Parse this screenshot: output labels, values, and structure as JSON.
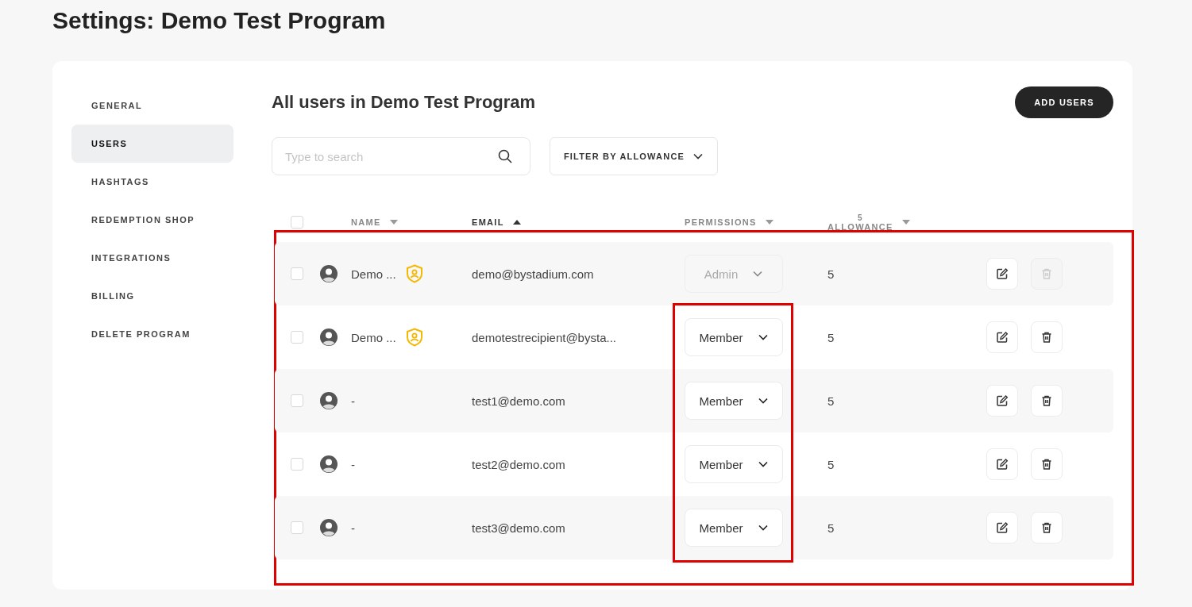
{
  "page_title": "Settings: Demo Test Program",
  "sidebar": {
    "items": [
      {
        "label": "GENERAL",
        "selected": false
      },
      {
        "label": "USERS",
        "selected": true
      },
      {
        "label": "HASHTAGS",
        "selected": false
      },
      {
        "label": "REDEMPTION SHOP",
        "selected": false
      },
      {
        "label": "INTEGRATIONS",
        "selected": false
      },
      {
        "label": "BILLING",
        "selected": false
      },
      {
        "label": "DELETE PROGRAM",
        "selected": false
      }
    ]
  },
  "heading": "All users in Demo Test Program",
  "add_button": "ADD USERS",
  "search": {
    "placeholder": "Type to search"
  },
  "filter": {
    "label": "FILTER BY ALLOWANCE"
  },
  "table": {
    "highlighted": true,
    "select_all": {
      "checked": false
    },
    "columns": [
      {
        "label": "NAME",
        "sort_ascending": false,
        "active": false
      },
      {
        "label": "EMAIL",
        "sort_ascending": true,
        "active": true
      },
      {
        "label": "PERMISSIONS",
        "sort_ascending": false,
        "active": false
      },
      {
        "count": "5",
        "label": "ALLOWANCE",
        "sort_ascending": false,
        "active": false
      }
    ],
    "rows": [
      {
        "checked": false,
        "name": "Demo ...",
        "admin": true,
        "email": "demo@bystadium.com",
        "permission": "Admin",
        "permission_disabled": true,
        "permission_highlighted": false,
        "allowance": "5",
        "delete_disabled": true
      },
      {
        "checked": false,
        "name": "Demo ...",
        "admin": true,
        "email": "demotestrecipient@bysta...",
        "permission": "Member",
        "permission_disabled": false,
        "permission_highlighted": true,
        "allowance": "5",
        "delete_disabled": false
      },
      {
        "checked": false,
        "name": "-",
        "admin": false,
        "email": "test1@demo.com",
        "permission": "Member",
        "permission_disabled": false,
        "permission_highlighted": true,
        "allowance": "5",
        "delete_disabled": false
      },
      {
        "checked": false,
        "name": "-",
        "admin": false,
        "email": "test2@demo.com",
        "permission": "Member",
        "permission_disabled": false,
        "permission_highlighted": true,
        "allowance": "5",
        "delete_disabled": false
      },
      {
        "checked": false,
        "name": "-",
        "admin": false,
        "email": "test3@demo.com",
        "permission": "Member",
        "permission_disabled": false,
        "permission_highlighted": true,
        "allowance": "5",
        "delete_disabled": false
      }
    ]
  }
}
